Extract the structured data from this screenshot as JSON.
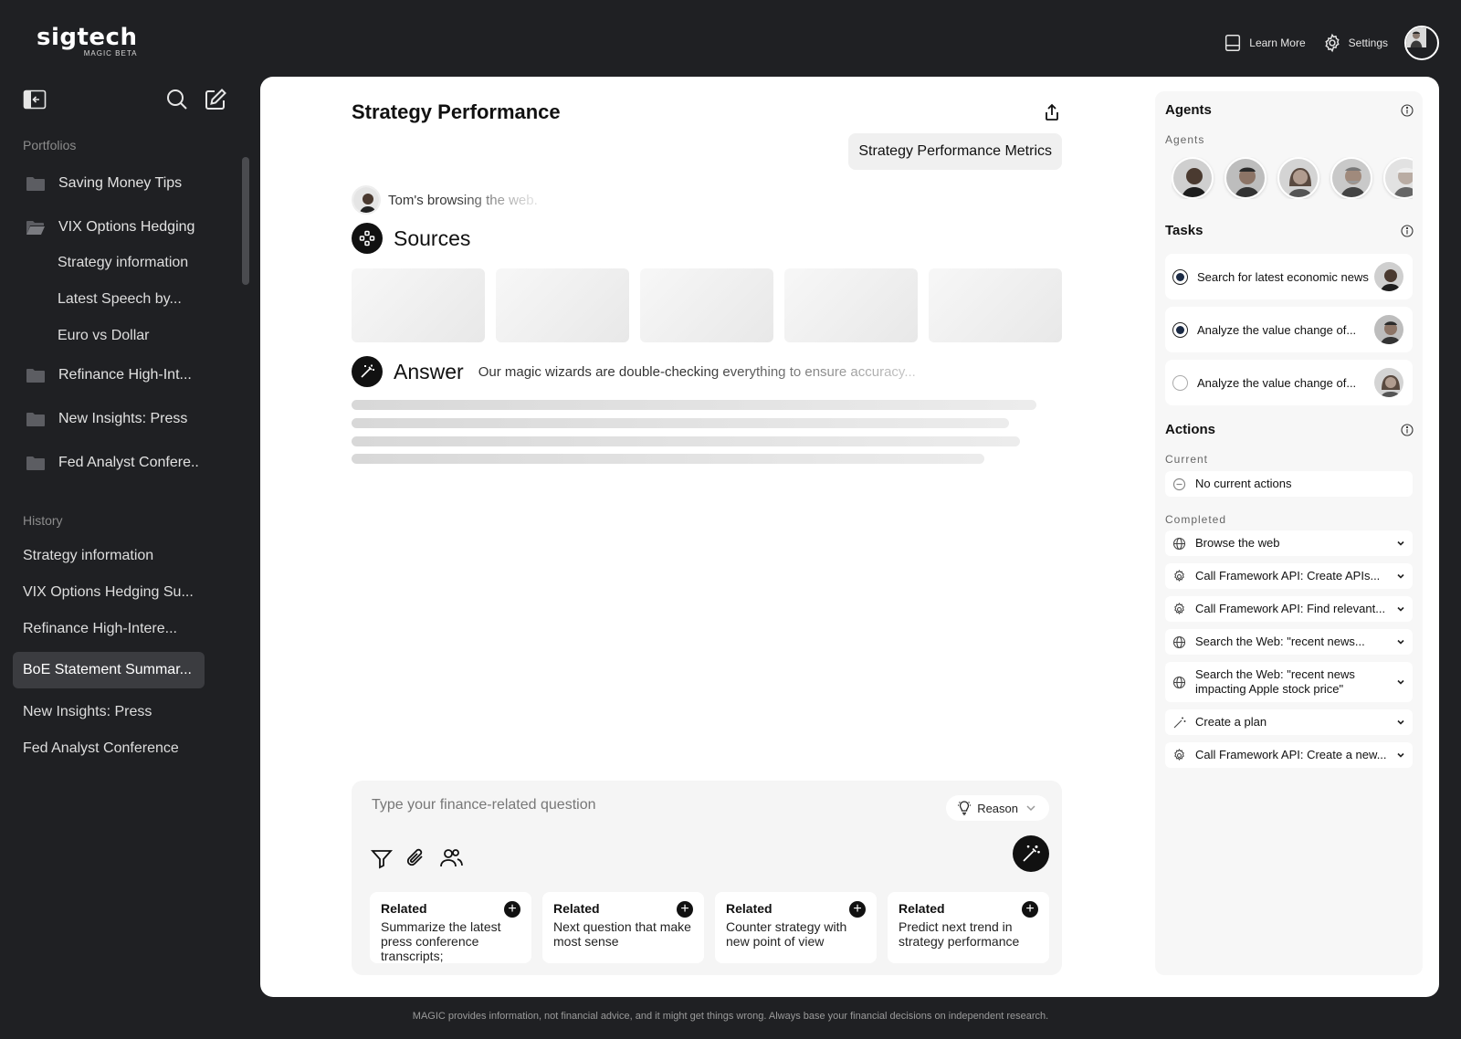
{
  "brand": {
    "name": "sigtech",
    "tagline": "MAGIC BETA"
  },
  "topnav": {
    "learn_more": "Learn More",
    "settings": "Settings"
  },
  "sidebar": {
    "portfolios_label": "Portfolios",
    "portfolios": [
      {
        "label": "Saving Money Tips",
        "icon": "folder-icon"
      },
      {
        "label": "VIX Options Hedging",
        "icon": "folder-open-icon",
        "children": [
          "Strategy information",
          "Latest Speech by...",
          "Euro vs Dollar"
        ]
      },
      {
        "label": "Refinance High-Int...",
        "icon": "folder-icon"
      },
      {
        "label": "New Insights: Press",
        "icon": "folder-icon"
      },
      {
        "label": "Fed Analyst Confere..",
        "icon": "folder-icon"
      }
    ],
    "history_label": "History",
    "history": [
      "Strategy information",
      "VIX Options Hedging Su...",
      "Refinance High-Intere...",
      "BoE Statement Summar...",
      "New Insights: Press",
      "Fed Analyst Conference"
    ],
    "active_history_index": 3
  },
  "main": {
    "title": "Strategy Performance",
    "query": "Strategy Performance Metrics",
    "browsing": "Tom's browsing the web.",
    "sources_label": "Sources",
    "answer_label": "Answer",
    "answer_note": "Our magic wizards are double-checking everything to ensure accuracy..."
  },
  "composer": {
    "placeholder": "Type your finance-related question",
    "mode": "Reason",
    "related": [
      {
        "heading": "Related",
        "text": "Summarize the latest press conference transcripts;"
      },
      {
        "heading": "Related",
        "text": "Next question that make most sense"
      },
      {
        "heading": "Related",
        "text": "Counter strategy with new point of view"
      },
      {
        "heading": "Related",
        "text": "Predict next trend in strategy performance"
      }
    ]
  },
  "panel": {
    "agents_title": "Agents",
    "agents_sub": "Agents",
    "tasks_title": "Tasks",
    "tasks": [
      {
        "label": "Search for latest economic news",
        "state": "active"
      },
      {
        "label": "Analyze the value change of...",
        "state": "active"
      },
      {
        "label": "Analyze the value change of...",
        "state": "pending"
      }
    ],
    "actions_title": "Actions",
    "current_label": "Current",
    "current": "No current actions",
    "completed_label": "Completed",
    "completed": [
      {
        "label": "Browse the web",
        "icon": "globe-icon"
      },
      {
        "label": "Call Framework API: Create APIs...",
        "icon": "gear-icon"
      },
      {
        "label": "Call Framework API: Find relevant...",
        "icon": "gear-icon"
      },
      {
        "label": "Search the Web: \"recent news...",
        "icon": "globe-icon"
      },
      {
        "label": "Search the Web: \"recent news impacting Apple stock price\"",
        "icon": "globe-icon"
      },
      {
        "label": "Create a plan",
        "icon": "wand-icon"
      },
      {
        "label": "Call Framework API: Create a new...",
        "icon": "gear-icon"
      }
    ]
  },
  "footer": "MAGIC provides information, not financial advice, and it might get things wrong. Always base your financial decisions on independent research."
}
